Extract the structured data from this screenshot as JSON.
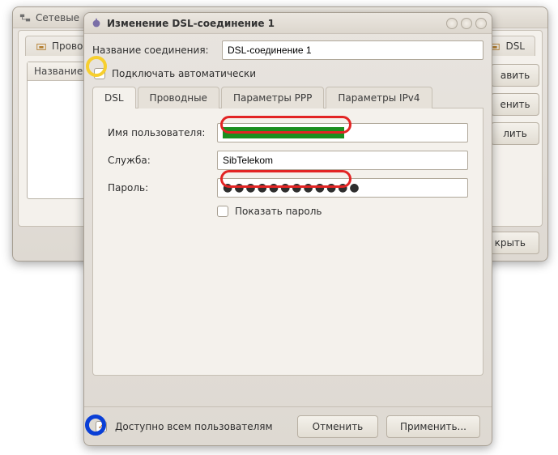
{
  "back_window": {
    "title": "Сетевые",
    "tabs": {
      "wired": "Проводн",
      "dsl": "DSL"
    },
    "list_header": "Название",
    "buttons": {
      "add": "авить",
      "edit": "енить",
      "delete": "лить",
      "close": "крыть"
    }
  },
  "dialog": {
    "title": "Изменение DSL-соединение 1",
    "name_label": "Название соединения:",
    "name_value": "DSL-соединение 1",
    "auto_connect": "Подключать автоматически",
    "tabs": {
      "dsl": "DSL",
      "wired": "Проводные",
      "ppp": "Параметры PPP",
      "ipv4": "Параметры IPv4"
    },
    "dsl_form": {
      "username_label": "Имя пользователя:",
      "service_label": "Служба:",
      "service_value": "SibTelekom",
      "password_label": "Пароль:",
      "password_value": "●●●●●●●●●●●●",
      "show_password": "Показать пароль"
    },
    "footer": {
      "all_users": "Доступно всем пользователям",
      "cancel": "Отменить",
      "apply": "Применить..."
    }
  }
}
